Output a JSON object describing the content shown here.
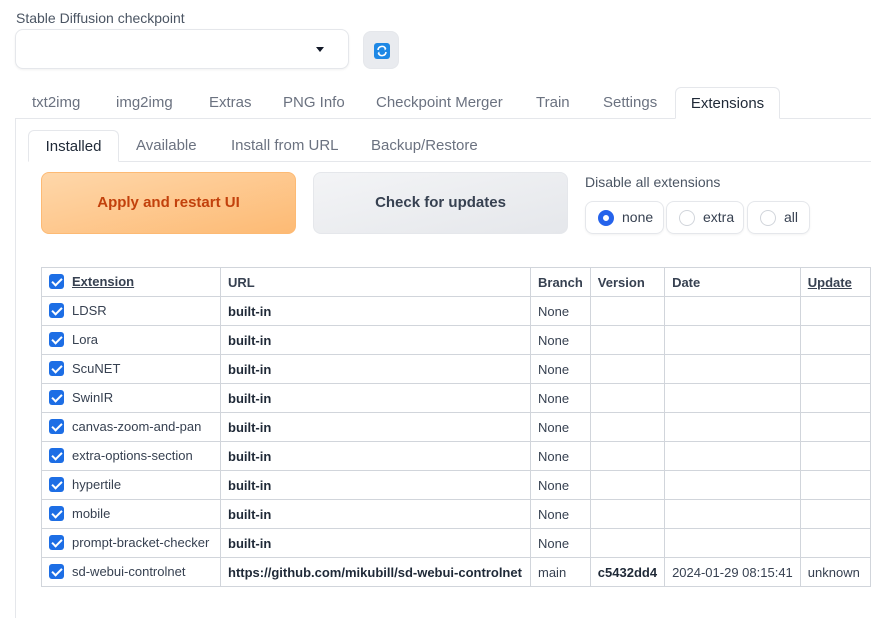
{
  "checkpoint": {
    "label": "Stable Diffusion checkpoint",
    "value": ""
  },
  "top_tabs": [
    {
      "label": "txt2img"
    },
    {
      "label": "img2img"
    },
    {
      "label": "Extras"
    },
    {
      "label": "PNG Info"
    },
    {
      "label": "Checkpoint Merger"
    },
    {
      "label": "Train"
    },
    {
      "label": "Settings"
    },
    {
      "label": "Extensions",
      "active": true
    }
  ],
  "sub_tabs": [
    {
      "label": "Installed",
      "active": true
    },
    {
      "label": "Available"
    },
    {
      "label": "Install from URL"
    },
    {
      "label": "Backup/Restore"
    }
  ],
  "buttons": {
    "apply": "Apply and restart UI",
    "check": "Check for updates"
  },
  "disable": {
    "label": "Disable all extensions",
    "options": [
      "none",
      "extra",
      "all"
    ],
    "selected": "none"
  },
  "table": {
    "headers": [
      "Extension",
      "URL",
      "Branch",
      "Version",
      "Date",
      "Update"
    ],
    "rows": [
      {
        "name": "LDSR",
        "url": "built-in",
        "branch": "None",
        "version": "",
        "date": "",
        "update": "",
        "enabled": true
      },
      {
        "name": "Lora",
        "url": "built-in",
        "branch": "None",
        "version": "",
        "date": "",
        "update": "",
        "enabled": true
      },
      {
        "name": "ScuNET",
        "url": "built-in",
        "branch": "None",
        "version": "",
        "date": "",
        "update": "",
        "enabled": true
      },
      {
        "name": "SwinIR",
        "url": "built-in",
        "branch": "None",
        "version": "",
        "date": "",
        "update": "",
        "enabled": true
      },
      {
        "name": "canvas-zoom-and-pan",
        "url": "built-in",
        "branch": "None",
        "version": "",
        "date": "",
        "update": "",
        "enabled": true
      },
      {
        "name": "extra-options-section",
        "url": "built-in",
        "branch": "None",
        "version": "",
        "date": "",
        "update": "",
        "enabled": true
      },
      {
        "name": "hypertile",
        "url": "built-in",
        "branch": "None",
        "version": "",
        "date": "",
        "update": "",
        "enabled": true
      },
      {
        "name": "mobile",
        "url": "built-in",
        "branch": "None",
        "version": "",
        "date": "",
        "update": "",
        "enabled": true
      },
      {
        "name": "prompt-bracket-checker",
        "url": "built-in",
        "branch": "None",
        "version": "",
        "date": "",
        "update": "",
        "enabled": true
      },
      {
        "name": "sd-webui-controlnet",
        "url": "https://github.com/mikubill/sd-webui-controlnet",
        "branch": "main",
        "version": "c5432dd4",
        "date": "2024-01-29 08:15:41",
        "update": "unknown",
        "enabled": true
      }
    ]
  },
  "colors": {
    "accent": "#1d6ee5",
    "apply_text": "#c2410c",
    "apply_bg": "#fdba74"
  }
}
